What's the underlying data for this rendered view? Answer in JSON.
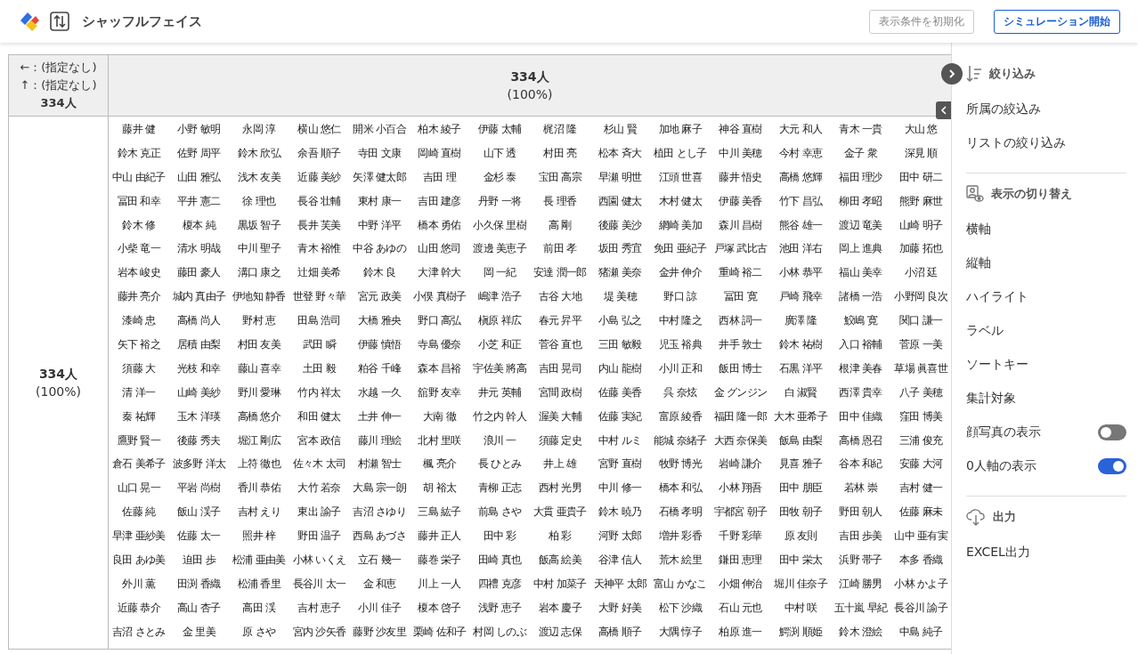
{
  "app": {
    "title": "シャッフルフェイス"
  },
  "header_buttons": [
    {
      "label": "表示条件を初期化",
      "disabled": true
    },
    {
      "label": "シミュレーション開始",
      "disabled": false
    }
  ],
  "matrix": {
    "corner": [
      "←：(指定なし)",
      "↑：(指定なし)",
      "334人"
    ],
    "column_header": {
      "count": "334人",
      "percent": "(100%)"
    },
    "row_header": {
      "count": "334人",
      "percent": "(100%)"
    },
    "rows": [
      [
        "藤井 健",
        "小野 敏明",
        "永岡 淳",
        "横山 悠仁",
        "開米 小百合",
        "柏木 綾子",
        "伊藤 太輔",
        "梶沼 隆",
        "杉山 賢",
        "加地 麻子",
        "神谷 直樹",
        "大元 和人",
        "青木 一貴",
        "大山 悠"
      ],
      [
        "鈴木 克正",
        "佐野 周平",
        "鈴木 欣弘",
        "余吾 順子",
        "寺田 文康",
        "岡崎 直樹",
        "山下 透",
        "村田 亮",
        "松本 斉大",
        "植田 とし子",
        "中川 美穂",
        "今村 幸恵",
        "金子 衆",
        "深見 順"
      ],
      [
        "中山 由紀子",
        "山田 雅弘",
        "浅木 友美",
        "近藤 美紗",
        "矢澤 健太郎",
        "吉田 理",
        "金杉 泰",
        "宝田 高宗",
        "早瀬 明世",
        "江頭 世喜",
        "藤井 悟史",
        "高橋 悠輝",
        "福田 理沙",
        "田中 研二"
      ],
      [
        "冨田 和幸",
        "平井 憲二",
        "徐 理也",
        "長谷 壮輔",
        "東村 康一",
        "吉田 建彦",
        "丹野 一将",
        "長 理香",
        "西園 健太",
        "木村 健太",
        "伊藤 美香",
        "竹下 昌弘",
        "柳田 孝昭",
        "熊野 麻世"
      ],
      [
        "鈴木 修",
        "榎本 純",
        "黒坂 智子",
        "長井 芙美",
        "中野 洋平",
        "橋本 勇佑",
        "小久保 里樹",
        "高 剛",
        "後藤 美沙",
        "網崎 美加",
        "森川 昌樹",
        "熊谷 雄一",
        "渡辺 竜美",
        "山崎 明子"
      ],
      [
        "小柴 竜一",
        "清水 明哉",
        "中川 聖子",
        "青木 裕惟",
        "中谷 あゆの",
        "山田 悠司",
        "渡邊 美恵子",
        "前田 孝",
        "坂田 秀宜",
        "免田 亜紀子",
        "戸塚 武比古",
        "池田 洋右",
        "岡上 進典",
        "加藤 拓也"
      ],
      [
        "岩本 峻史",
        "藤田 豪人",
        "溝口 康之",
        "辻畑 美希",
        "鈴木 良",
        "大津 幹大",
        "岡 一紀",
        "安達 潤一郎",
        "猪瀬 美奈",
        "金井 伸介",
        "重崎 裕二",
        "小林 恭平",
        "福山 美幸",
        "小沼 廷"
      ],
      [
        "藤井 亮介",
        "城内 真由子",
        "伊地知 静香",
        "世登 野々華",
        "宮元 政美",
        "小俣 真樹子",
        "嶋津 浩子",
        "古谷 大地",
        "堤 美穂",
        "野口 諒",
        "冨田 寛",
        "戸崎 飛幸",
        "諸橋 一浩",
        "小野岡 良次"
      ],
      [
        "漆崎 忠",
        "高橋 尚人",
        "野村 恵",
        "田島 浩司",
        "大橋 雅央",
        "野口 高弘",
        "槇原 祥広",
        "春元 昇平",
        "小島 弘之",
        "中村 隆之",
        "西林 詞一",
        "廣澤 隆",
        "鮫嶋 寛",
        "関口 謙一"
      ],
      [
        "矢下 裕之",
        "居積 由梨",
        "村田 友美",
        "武田 瞬",
        "伊藤 慎悟",
        "寺島 優奈",
        "小芝 和正",
        "菅谷 直也",
        "三田 敏毅",
        "児玉 裕典",
        "井手 敦士",
        "鈴木 祐樹",
        "入口 裕輔",
        "菅原 一美"
      ],
      [
        "須藤 大",
        "光枝 和幸",
        "藤山 喜幸",
        "土田 毅",
        "粕谷 千峰",
        "森本 昌裕",
        "宇佐美 將高",
        "吉田 晃司",
        "内山 龍樹",
        "小川 正和",
        "飯田 博士",
        "石黒 洋平",
        "根津 美春",
        "草場 眞喜世"
      ],
      [
        "清 洋一",
        "山崎 美紗",
        "野川 愛琳",
        "竹内 祥太",
        "水越 一久",
        "舘野 友幸",
        "井元 英輔",
        "宮間 政樹",
        "佐藤 美香",
        "呉 奈炫",
        "金 グンジン",
        "白 淑賢",
        "西澤 貴幸",
        "八子 美穂"
      ],
      [
        "秦 祐輝",
        "玉木 洋瑛",
        "高橋 悠介",
        "和田 健太",
        "土井 伸一",
        "大南 徹",
        "竹之内 幹人",
        "渥美 大輔",
        "佐藤 実紀",
        "富原 綾香",
        "福田 隆一郎",
        "大木 亜希子",
        "田中 佳織",
        "窪田 博美"
      ],
      [
        "鷹野 賢一",
        "後藤 秀夫",
        "堀江 剛広",
        "宮本 政信",
        "藤川 理絵",
        "北村 里咲",
        "浪川 一",
        "須藤 定史",
        "中村 ルミ",
        "能城 奈緒子",
        "大西 奈保美",
        "飯島 由梨",
        "高橋 恩召",
        "三浦 俊充"
      ],
      [
        "倉石 美希子",
        "波多野 洋太",
        "上符 徹也",
        "佐々木 太司",
        "村瀬 智士",
        "楓 亮介",
        "長 ひとみ",
        "井上 雄",
        "宮野 直樹",
        "牧野 博光",
        "岩崎 謙介",
        "見喜 雅子",
        "谷本 和紀",
        "安藤 大河"
      ],
      [
        "山口 晃一",
        "平岩 尚樹",
        "香川 恭佑",
        "大竹 若奈",
        "大島 宗一朗",
        "胡 裕太",
        "青柳 正志",
        "西村 光男",
        "中川 修一",
        "橋本 和弘",
        "小林 翔吾",
        "田中 朋臣",
        "若林 崇",
        "吉村 健一"
      ],
      [
        "佐藤 純",
        "飯山 渓子",
        "吉村 えり",
        "東出 諭子",
        "吉沼 さゆり",
        "三島 紘子",
        "前島 さや",
        "大貫 亜貴子",
        "鈴木 暁乃",
        "石橋 孝明",
        "宇都宮 朝子",
        "田牧 朝子",
        "野田 朝人",
        "佐藤 麻未"
      ],
      [
        "早津 亜紗美",
        "佐藤 太一",
        "照井 梓",
        "野田 温子",
        "西島 あづさ",
        "藤井 正人",
        "田中 彩",
        "柏 彩",
        "河野 太郎",
        "増井 彩香",
        "千野 彩華",
        "原 友則",
        "吉田 歩美",
        "山中 亜有実"
      ],
      [
        "良田 あゆ美",
        "迫田 歩",
        "松浦 亜由美",
        "小林 いくえ",
        "立石 幾一",
        "藤巻 栄子",
        "田崎 真也",
        "飯高 絵美",
        "谷津 信人",
        "荒木 絵里",
        "鎌田 恵理",
        "田中 栄太",
        "浜野 帯子",
        "本多 香織"
      ],
      [
        "外川 薫",
        "田渕 香織",
        "松浦 香里",
        "長谷川 太一",
        "金 和恵",
        "川上 一人",
        "四禮 克彦",
        "中村 加菜子",
        "天神平 太郎",
        "富山 かなこ",
        "小畑 伸治",
        "堀川 佳奈子",
        "江崎 勝男",
        "小林 かよ子"
      ],
      [
        "近藤 恭介",
        "高山 杏子",
        "高田 渓",
        "吉村 恵子",
        "小川 佳子",
        "榎本 啓子",
        "浅野 恵子",
        "岩本 慶子",
        "大野 好美",
        "松下 沙織",
        "石山 元也",
        "中村 咲",
        "五十嵐 早紀",
        "長谷川 諭子"
      ],
      [
        "吉沼 さとみ",
        "金 里美",
        "原 さや",
        "宮内 沙矢香",
        "藤野 沙友里",
        "栗崎 佐和子",
        "村岡 しのぶ",
        "渡辺 志保",
        "高橋 順子",
        "大隅 惇子",
        "柏原 進一",
        "鰐渕 順姫",
        "鈴木 澄絵",
        "中島 純子"
      ]
    ]
  },
  "sidebar": {
    "sections": [
      {
        "kind": "filter",
        "title": "絞り込み",
        "items": [
          {
            "kind": "item",
            "label": "所属の絞込み"
          },
          {
            "kind": "item",
            "label": "リストの絞り込み"
          }
        ]
      },
      {
        "kind": "display",
        "title": "表示の切り替え",
        "items": [
          {
            "kind": "item",
            "label": "横軸"
          },
          {
            "kind": "item",
            "label": "縦軸"
          },
          {
            "kind": "item",
            "label": "ハイライト"
          },
          {
            "kind": "item",
            "label": "ラベル"
          },
          {
            "kind": "item",
            "label": "ソートキー"
          },
          {
            "kind": "item",
            "label": "集計対象"
          },
          {
            "kind": "toggle",
            "label": "顔写真の表示",
            "on": false
          },
          {
            "kind": "toggle",
            "label": "0人軸の表示",
            "on": true
          }
        ]
      },
      {
        "kind": "output",
        "title": "出力",
        "items": [
          {
            "kind": "item",
            "label": "EXCEL出力"
          }
        ]
      }
    ]
  }
}
